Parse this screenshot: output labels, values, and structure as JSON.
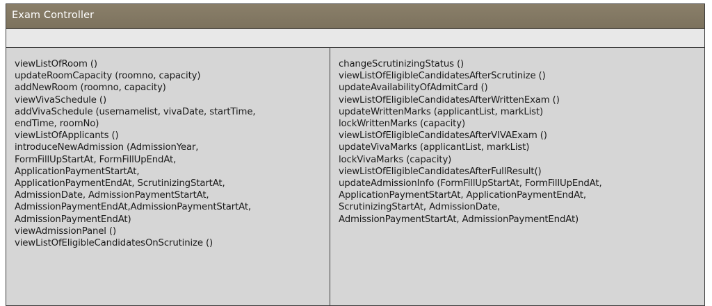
{
  "class_box": {
    "title": "Exam Controller",
    "left_operations": [
      "viewListOfRoom ()",
      "updateRoomCapacity (roomno, capacity)",
      "addNewRoom (roomno, capacity)",
      "viewVivaSchedule ()",
      "addVivaSchedule (usernamelist, vivaDate, startTime,",
      "endTime, roomNo)",
      "viewListOfApplicants ()",
      "introduceNewAdmission (AdmissionYear,",
      "FormFillUpStartAt, FormFillUpEndAt,",
      "ApplicationPaymentStartAt,",
      "ApplicationPaymentEndAt, ScrutinizingStartAt,",
      "AdmissionDate, AdmissionPaymentStartAt,",
      "AdmissionPaymentEndAt,AdmissionPaymentStartAt,",
      "AdmissionPaymentEndAt)",
      "viewAdmissionPanel ()",
      "viewListOfEligibleCandidatesOnScrutinize ()"
    ],
    "right_operations": [
      "changeScrutinizingStatus ()",
      "viewListOfEligibleCandidatesAfterScrutinize ()",
      "updateAvailabilityOfAdmitCard ()",
      "viewListOfEligibleCandidatesAfterWrittenExam ()",
      "updateWrittenMarks (applicantList, markList)",
      "lockWrittenMarks (capacity)",
      "viewListOfEligibleCandidatesAfterVIVAExam ()",
      "updateVivaMarks (applicantList, markList)",
      "lockVivaMarks (capacity)",
      "viewListOfEligibleCandidatesAfterFullResult()",
      "updateAdmissionInfo (FormFillUpStartAt, FormFillUpEndAt,",
      "ApplicationPaymentStartAt, ApplicationPaymentEndAt,",
      "ScrutinizingStartAt, AdmissionDate,",
      "AdmissionPaymentStartAt, AdmissionPaymentEndAt)"
    ]
  }
}
